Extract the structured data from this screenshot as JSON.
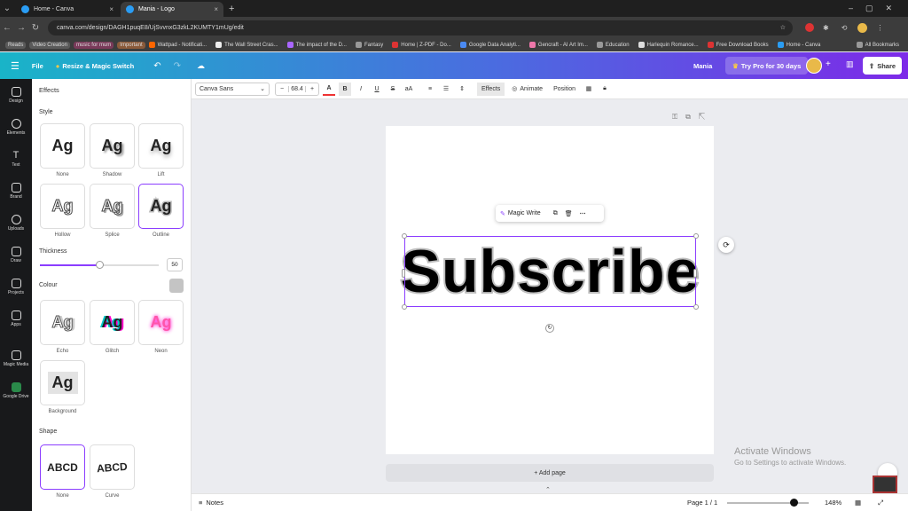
{
  "browser": {
    "tabs": [
      {
        "title": "Home - Canva"
      },
      {
        "title": "Mania - Logo"
      }
    ],
    "url": "canva.com/design/DAGH1puqE8/UjSvvnxG3zkL2KUMTY1mUg/edit",
    "bookmarks": [
      "Reads",
      "Video Creation",
      "music for mum",
      "Important",
      "Wattpad - Notificati...",
      "The Wall Street Cras...",
      "The impact of the D...",
      "Fantasy",
      "Home | Z-PDF - Do...",
      "Google Data Analyti...",
      "Gencraft - AI Art Im...",
      "Education",
      "Harlequin Romance...",
      "Free Download Books",
      "Home - Canva",
      "All Bookmarks"
    ]
  },
  "topbar": {
    "file": "File",
    "resize": "Resize & Magic Switch",
    "title": "Mania",
    "try_pro": "Try Pro for 30 days",
    "share": "Share"
  },
  "rail": [
    "Design",
    "Elements",
    "Text",
    "Brand",
    "Uploads",
    "Draw",
    "Projects",
    "Apps",
    "Magic Media",
    "Google Drive"
  ],
  "panel": {
    "heading": "Effects",
    "style_label": "Style",
    "style_sample": "Ag",
    "styles": [
      "None",
      "Shadow",
      "Lift",
      "Hollow",
      "Splice",
      "Outline",
      "Echo",
      "Glitch",
      "Neon",
      "Background"
    ],
    "thickness_label": "Thickness",
    "thickness_value": "50",
    "thickness_fraction": 0.5,
    "colour_label": "Colour",
    "colour_value": "#c4c4c4",
    "shape_label": "Shape",
    "shape_sample": "ABCD",
    "shapes": [
      "None",
      "Curve"
    ]
  },
  "toolbar": {
    "font": "Canva Sans",
    "font_size": "68.4",
    "minus": "−",
    "plus": "+",
    "effects": "Effects",
    "animate": "Animate",
    "position": "Position"
  },
  "canvas": {
    "text": "Subscribe",
    "magic_write": "Magic Write",
    "add_page": "+ Add page"
  },
  "bottombar": {
    "notes": "Notes",
    "page": "Page 1 / 1",
    "zoom": "148%",
    "zoom_fraction": 0.82
  },
  "watermark": {
    "line1": "Activate Windows",
    "line2": "Go to Settings to activate Windows."
  },
  "colors": {
    "accent": "#8b3dff"
  }
}
